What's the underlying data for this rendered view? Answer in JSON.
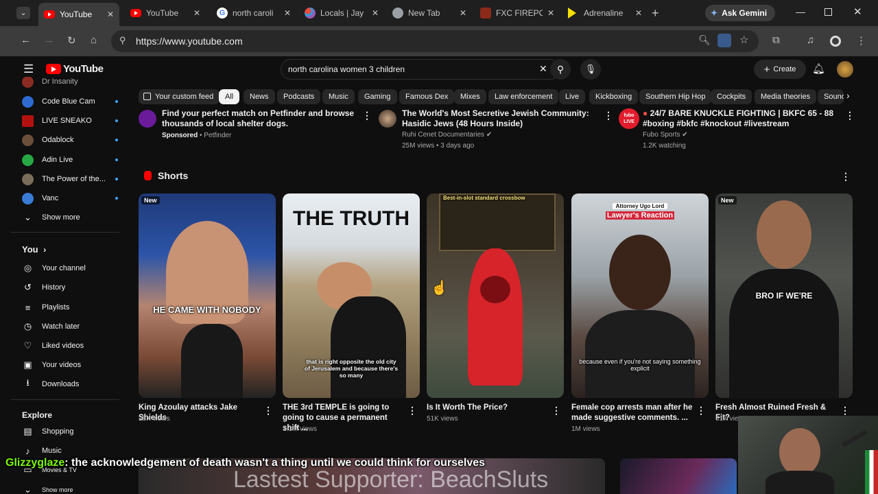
{
  "browser": {
    "tabs": [
      {
        "title": "YouTube",
        "favicon": "youtube-icon",
        "active": true
      },
      {
        "title": "YouTube",
        "favicon": "youtube-icon",
        "active": false
      },
      {
        "title": "north caroli",
        "favicon": "google-icon",
        "active": false
      },
      {
        "title": "Locals | Jay",
        "favicon": "locals-icon",
        "active": false
      },
      {
        "title": "New Tab",
        "favicon": "chrome-icon",
        "active": false
      },
      {
        "title": "FXC FIREPO",
        "favicon": "fxc-icon",
        "active": false
      },
      {
        "title": "Adrenaline",
        "favicon": "play-icon",
        "active": false
      }
    ],
    "ask_gemini_label": "Ask Gemini",
    "url": "https://www.youtube.com"
  },
  "youtube": {
    "logo_text": "YouTube",
    "search_value": "north carolina women 3 children",
    "create_label": "Create",
    "chips": [
      "Your custom feed",
      "All",
      "News",
      "Podcasts",
      "Music",
      "Gaming",
      "Famous Dex",
      "Mixes",
      "Law enforcement",
      "Live",
      "Kickboxing",
      "Southern Hip Hop",
      "Cockpits",
      "Media theories",
      "Sound"
    ]
  },
  "sidebar": {
    "subscriptions": [
      {
        "label": "Dr Insanity",
        "color": "#c0392b"
      },
      {
        "label": "Code Blue Cam",
        "color": "#2e6bd1"
      },
      {
        "label": "LIVE SNEAKO",
        "color": "#b51010"
      },
      {
        "label": "Odablock",
        "color": "#6b4f3b"
      },
      {
        "label": "Adin Live",
        "color": "#27a844"
      },
      {
        "label": "The Power of the...",
        "color": "#7a6d5a"
      },
      {
        "label": "Vanc",
        "color": "#3a7bd5"
      }
    ],
    "show_more": "Show more",
    "you_heading": "You",
    "you_items": [
      {
        "label": "Your channel",
        "icon": "channel-icon",
        "glyph": "◎"
      },
      {
        "label": "History",
        "icon": "history-icon",
        "glyph": "↺"
      },
      {
        "label": "Playlists",
        "icon": "playlists-icon",
        "glyph": "≡"
      },
      {
        "label": "Watch later",
        "icon": "clock-icon",
        "glyph": "◷"
      },
      {
        "label": "Liked videos",
        "icon": "thumbs-up-icon",
        "glyph": "👍"
      },
      {
        "label": "Your videos",
        "icon": "your-videos-icon",
        "glyph": "▶"
      },
      {
        "label": "Downloads",
        "icon": "download-icon",
        "glyph": "⭳"
      }
    ],
    "explore_heading": "Explore",
    "explore_items": [
      {
        "label": "Shopping",
        "icon": "shopping-icon",
        "glyph": "🛍"
      },
      {
        "label": "Music",
        "icon": "music-icon",
        "glyph": "♪"
      },
      {
        "label": "Movies & TV",
        "icon": "movies-icon",
        "glyph": "🎞"
      }
    ],
    "show_more_bottom": "Show more"
  },
  "top_videos": [
    {
      "title": "Find your perfect match on Petfinder and browse thousands of local shelter dogs.",
      "sponsored": "Sponsored",
      "channel": "Petfinder"
    },
    {
      "title": "The World's Most Secretive Jewish Community: Hasidic Jews (48 Hours Inside)",
      "channel": "Ruhi Cenet Documentaries",
      "meta": "25M views • 3 days ago"
    },
    {
      "title": "24/7 BARE KNUCKLE FIGHTING | BKFC 65 - 88 #boxing #bkfc #knockout #livestream",
      "channel": "Fubo Sports",
      "meta": "1.2K watching",
      "avatar_text": "fubo LIVE"
    }
  ],
  "shorts_heading": "Shorts",
  "shorts": [
    {
      "title": "King Azoulay attacks Jake Shields",
      "views": "25K views",
      "badge": "New",
      "caption": "HE CAME WITH NOBODY"
    },
    {
      "title": "THE 3rd TEMPLE is going to going to cause a permanent shift ...",
      "views": "1.3M views",
      "caption_top": "THE TRUTH",
      "caption": "that is right opposite the old city of Jerusalem and because there's so many"
    },
    {
      "title": "Is It Worth The Price?",
      "views": "51K views",
      "caption": "Best-in-slot standard crossbow"
    },
    {
      "title": "Female cop arrests man after he made suggestive comments. ...",
      "views": "1M views",
      "caption_top": "Attorney Ugo Lord",
      "caption_tag": "Lawyer's Reaction",
      "caption": "because even if you're not saying something explicit"
    },
    {
      "title": "Fresh Almost Ruined Fresh & Fit?",
      "views": "61K views",
      "badge": "New",
      "caption": "BRO IF WE'RE"
    }
  ],
  "overlay": {
    "chat_user": "Glizzyglaze",
    "chat_message": ": the acknowledgement of death wasn't a thing until we could think for ourselves",
    "banner_text": "Lastest Supporter: BeachSluts"
  }
}
